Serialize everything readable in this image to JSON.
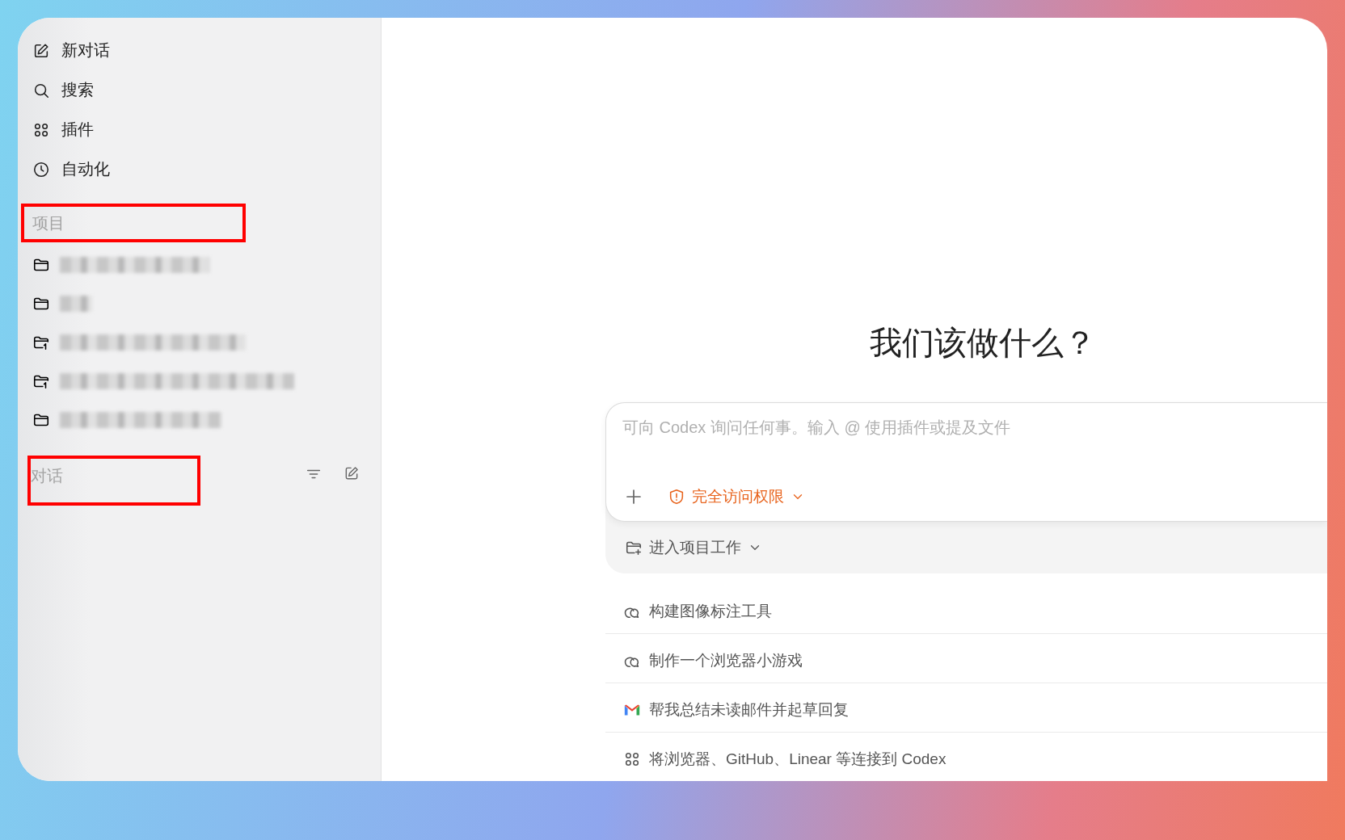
{
  "sidebar": {
    "nav": [
      {
        "kind": "compose",
        "label": "新对话"
      },
      {
        "kind": "search",
        "label": "搜索"
      },
      {
        "kind": "plugins",
        "label": "插件"
      },
      {
        "kind": "clock",
        "label": "自动化"
      }
    ],
    "projects": {
      "heading": "项目",
      "highlighted": true,
      "items": [
        {
          "kind": "folder"
        },
        {
          "kind": "folder"
        },
        {
          "kind": "branch"
        },
        {
          "kind": "branch"
        },
        {
          "kind": "folder"
        }
      ]
    },
    "conversations": {
      "heading": "对话",
      "highlighted": true
    }
  },
  "main": {
    "title": "我们该做什么？",
    "composer": {
      "placeholder": "可向 Codex 询问任何事。输入 @ 使用插件或提及文件",
      "access": "完全访问权限"
    },
    "project_picker": "进入项目工作",
    "suggestions": [
      {
        "kind": "chat",
        "label": "构建图像标注工具"
      },
      {
        "kind": "chat",
        "label": "制作一个浏览器小游戏"
      },
      {
        "kind": "mail",
        "label": "帮我总结未读邮件并起草回复"
      },
      {
        "kind": "plugins",
        "label": "将浏览器、GitHub、Linear 等连接到 Codex"
      }
    ]
  }
}
